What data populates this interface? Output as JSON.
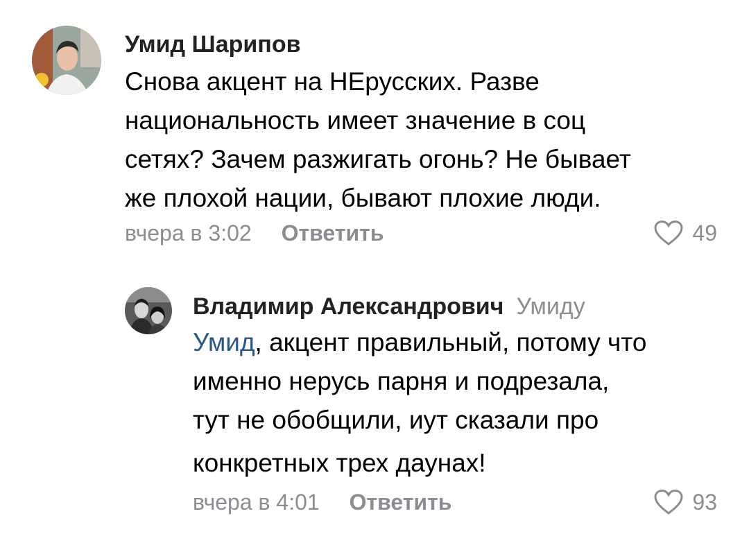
{
  "comments": [
    {
      "author": "Умид Шарипов",
      "text_lines": [
        "Снова акцент на НЕрусских. Разве",
        "национальность имеет значение в соц",
        "сетях? Зачем разжигать огонь? Не бывает",
        "же плохой нации, бывают плохие люди."
      ],
      "time": "вчера в 3:02",
      "reply_label": "Ответить",
      "likes": "49"
    },
    {
      "author": "Владимир Александрович",
      "reply_to": "Умиду",
      "mention": "Умид",
      "text_lines": [
        ", акцент правильный, потому что",
        "именно нерусь парня и подрезала,",
        "тут не обобщили, иут сказали про",
        "конкретных трех даунах!"
      ],
      "time": "вчера в 4:01",
      "reply_label": "Ответить",
      "likes": "93"
    }
  ],
  "colors": {
    "secondary": "#8a8d91",
    "link": "#2a5885",
    "heart": "#8a8d91"
  },
  "icons": {
    "avatar_1": "user-avatar-photo",
    "avatar_2": "user-avatar-photo",
    "like": "heart-outline-icon"
  }
}
